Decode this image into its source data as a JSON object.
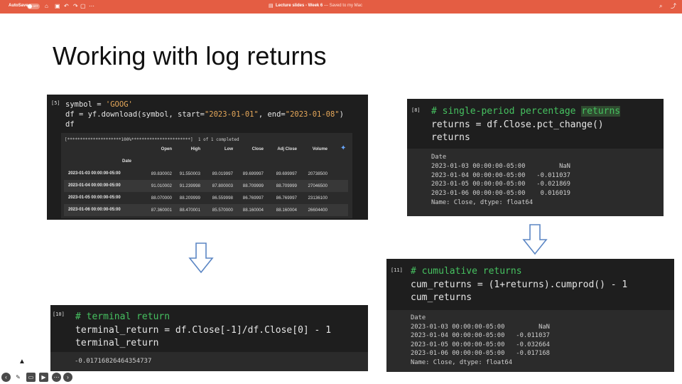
{
  "topbar": {
    "autosave_label": "AutoSave",
    "autosave_state": "OFF",
    "doc_title": "Lecture slides - Week 6",
    "doc_subtitle": "— Saved to my Mac",
    "icons": [
      "home-icon",
      "save-icon",
      "undo-icon",
      "redo-icon",
      "more-icon",
      "search-icon",
      "share-icon"
    ]
  },
  "slide": {
    "title": "Working with log returns"
  },
  "cell5": {
    "prompt": "[5]",
    "code_lines": [
      [
        "symbol = ",
        "'GOOG'"
      ],
      [
        "df = yf.download(symbol, start=",
        "\"2023-01-01\"",
        ", end=",
        "\"2023-01-08\"",
        ")"
      ],
      [
        "df",
        ""
      ]
    ],
    "progress": "[*********************100%***********************]  1 of 1 completed",
    "table": {
      "columns": [
        "Open",
        "High",
        "Low",
        "Close",
        "Adj Close",
        "Volume"
      ],
      "index_name": "Date",
      "rows": [
        {
          "date": "2023-01-03 00:00:00-05:00",
          "values": [
            "89.830002",
            "91.550003",
            "89.019997",
            "89.699997",
            "89.699997",
            "20738500"
          ]
        },
        {
          "date": "2023-01-04 00:00:00-05:00",
          "values": [
            "91.010002",
            "91.239998",
            "87.800003",
            "88.709999",
            "88.709999",
            "27046500"
          ]
        },
        {
          "date": "2023-01-05 00:00:00-05:00",
          "values": [
            "88.070000",
            "88.209999",
            "86.559998",
            "86.769997",
            "86.769997",
            "23136100"
          ]
        },
        {
          "date": "2023-01-06 00:00:00-05:00",
          "values": [
            "87.360001",
            "88.470001",
            "85.570000",
            "88.160004",
            "88.160004",
            "26604400"
          ]
        }
      ]
    }
  },
  "cell8": {
    "prompt": "[8]",
    "comment_a": "# single-period percentage ",
    "comment_b": "returns",
    "line2": "returns = df.Close.pct_change()",
    "line3": "returns",
    "output": "Date\n2023-01-03 00:00:00-05:00         NaN\n2023-01-04 00:00:00-05:00   -0.011037\n2023-01-05 00:00:00-05:00   -0.021869\n2023-01-06 00:00:00-05:00    0.016019\nName: Close, dtype: float64"
  },
  "cell10": {
    "prompt": "[10]",
    "comment": "# terminal return",
    "line2": "terminal_return = df.Close[-1]/df.Close[0] - 1",
    "line3": "terminal_return",
    "output": "-0.01716826464354737"
  },
  "cell11": {
    "prompt": "[11]",
    "comment": "# cumulative returns",
    "line2": "cum_returns = (1+returns).cumprod() - 1",
    "line3": "cum_returns",
    "output": "Date\n2023-01-03 00:00:00-05:00         NaN\n2023-01-04 00:00:00-05:00   -0.011037\n2023-01-05 00:00:00-05:00   -0.032664\n2023-01-06 00:00:00-05:00   -0.017168\nName: Close, dtype: float64"
  },
  "colors": {
    "topbar": "#e45d43",
    "panel": "#1e1e1e",
    "comment": "#46c160",
    "arrow": "#5b86c4"
  },
  "bottom_toolbar": [
    "prev-icon",
    "pen-icon",
    "subtitles-icon",
    "camera-icon",
    "more-icon",
    "next-icon"
  ]
}
